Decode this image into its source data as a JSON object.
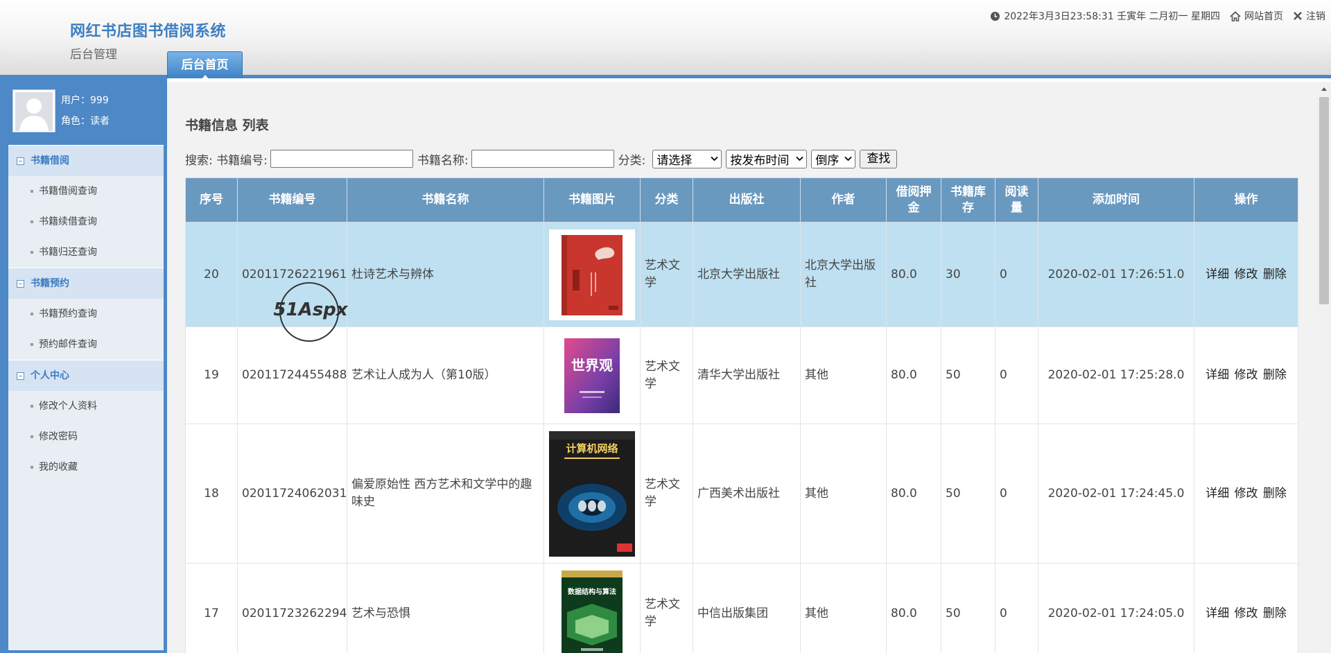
{
  "header": {
    "title": "网红书店图书借阅系统",
    "subtitle": "后台管理",
    "tab": "后台首页",
    "datetime": "2022年3月3日23:58:31 壬寅年 二月初一 星期四",
    "home_link": "网站首页",
    "logout_link": "注销"
  },
  "user": {
    "name_line": "用户：999",
    "role_line": "角色：读者"
  },
  "sidebar": {
    "groups": [
      {
        "title": "书籍借阅",
        "items": [
          "书籍借阅查询",
          "书籍续借查询",
          "书籍归还查询"
        ]
      },
      {
        "title": "书籍预约",
        "items": [
          "书籍预约查询",
          "预约邮件查询"
        ]
      },
      {
        "title": "个人中心",
        "items": [
          "修改个人资料",
          "修改密码",
          "我的收藏"
        ]
      }
    ]
  },
  "main": {
    "page_title": "书籍信息 列表",
    "search": {
      "prefix": "搜索: 书籍编号:",
      "name_label": "书籍名称:",
      "category_label": "分类:",
      "category_value": "请选择",
      "sort_value": "按发布时间",
      "order_value": "倒序",
      "find_button": "查找",
      "code_value": "",
      "name_value": ""
    },
    "table": {
      "headers": [
        "序号",
        "书籍编号",
        "书籍名称",
        "书籍图片",
        "分类",
        "出版社",
        "作者",
        "借阅押金",
        "书籍库存",
        "阅读量",
        "添加时间",
        "操作"
      ],
      "header_lines": {
        "deposit": [
          "借阅押",
          "金"
        ],
        "stock": [
          "书籍库",
          "存"
        ],
        "reads": [
          "阅读",
          "量"
        ]
      },
      "rows": [
        {
          "no": "20",
          "code": "02011726221961",
          "name": "杜诗艺术与辨体",
          "category": "艺术文学",
          "publisher": "北京大学出版社",
          "author": "北京大学出版社",
          "deposit": "80.0",
          "stock": "30",
          "reads": "0",
          "added": "2020-02-01 17:26:51.0",
          "cover_text": ""
        },
        {
          "no": "19",
          "code": "02011724455488",
          "name": "艺术让人成为人（第10版）",
          "category": "艺术文学",
          "publisher": "清华大学出版社",
          "author": "其他",
          "deposit": "80.0",
          "stock": "50",
          "reads": "0",
          "added": "2020-02-01 17:25:28.0",
          "cover_text": "世界观"
        },
        {
          "no": "18",
          "code": "02011724062031",
          "name": "偏爱原始性 西方艺术和文学中的趣味史",
          "category": "艺术文学",
          "publisher": "广西美术出版社",
          "author": "其他",
          "deposit": "80.0",
          "stock": "50",
          "reads": "0",
          "added": "2020-02-01 17:24:45.0",
          "cover_text": "计算机网络"
        },
        {
          "no": "17",
          "code": "02011723262294",
          "name": "艺术与恐惧",
          "category": "艺术文学",
          "publisher": "中信出版集团",
          "author": "其他",
          "deposit": "80.0",
          "stock": "50",
          "reads": "0",
          "added": "2020-02-01 17:24:05.0",
          "cover_text": "数据结构与算法"
        }
      ],
      "ops": {
        "detail": "详细",
        "edit": "修改",
        "delete": "删除"
      }
    },
    "watermark": "51Aspx"
  },
  "colors": {
    "brand": "#3f7ec2",
    "sidebar_bg": "#4d88c7",
    "table_header": "#6a99c0",
    "selected_row": "#bfe0f0"
  },
  "icons": [
    "clock-icon",
    "home-icon",
    "close-icon",
    "user-avatar-icon"
  ]
}
